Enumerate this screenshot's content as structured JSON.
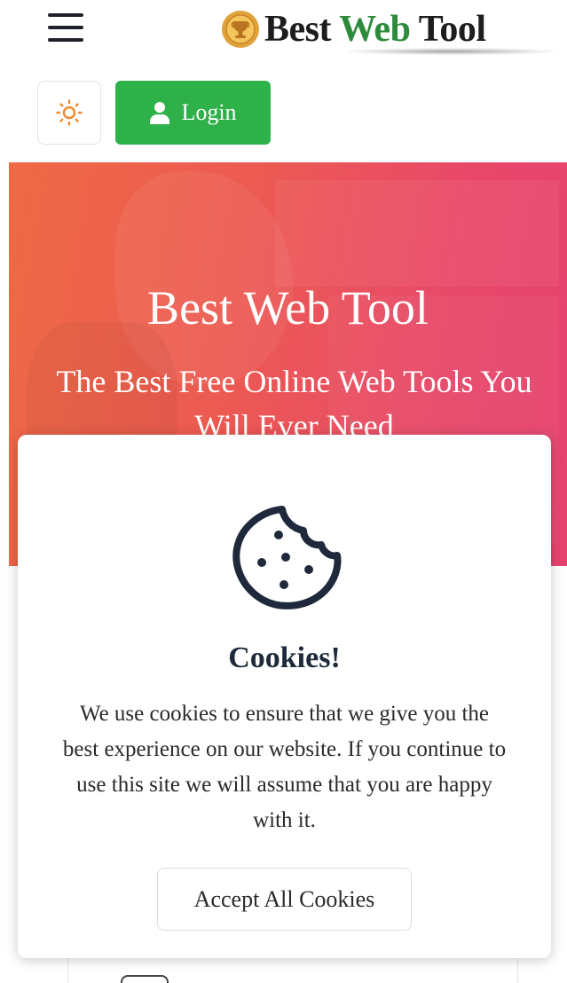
{
  "header": {
    "logo": {
      "word1": "Best",
      "word2": "Web",
      "word3": "Tool"
    },
    "login_label": "Login"
  },
  "hero": {
    "title": "Best Web Tool",
    "subtitle": "The Best Free Online Web Tools You Will Ever Need"
  },
  "cookie_banner": {
    "title": "Cookies!",
    "message": "We use cookies to ensure that we give you the best experience on our website. If you continue to use this site we will assume that you are happy with it.",
    "accept_label": "Accept All Cookies"
  },
  "icons": {
    "menu": "hamburger-menu-icon",
    "theme": "sun-icon",
    "login": "user-icon",
    "logo": "trophy-medal-icon",
    "cookie": "cookie-icon"
  },
  "colors": {
    "brand_green": "#2e8b3d",
    "login_green": "#2fb14a",
    "hero_gradient_start": "#ef6a45",
    "hero_gradient_end": "#e6426f",
    "sun_orange": "#f08a2e",
    "cookie_navy": "#1e2a3b"
  }
}
